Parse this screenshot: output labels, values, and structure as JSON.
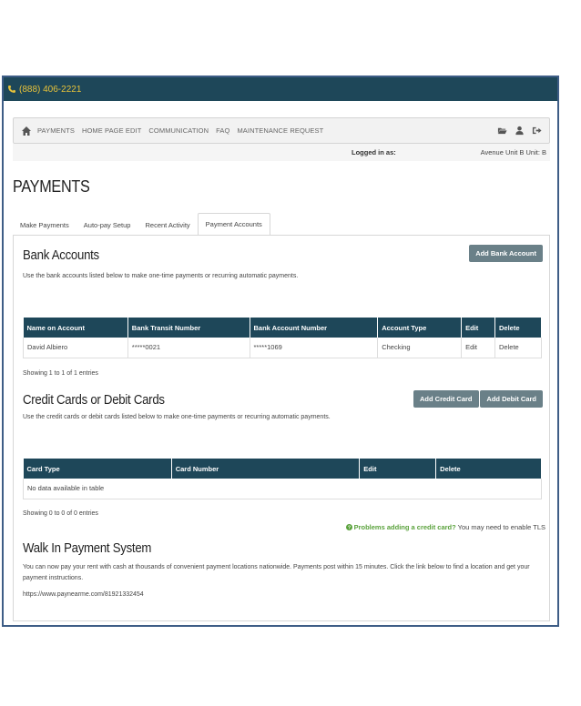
{
  "header": {
    "phone": "(888) 406-2221"
  },
  "nav": {
    "items": [
      "PAYMENTS",
      "HOME PAGE EDIT",
      "COMMUNICATION",
      "FAQ",
      "MAINTENANCE REQUEST"
    ]
  },
  "session": {
    "logged_in_label": "Logged in as:",
    "address": "Avenue Unit B Unit: B"
  },
  "page": {
    "title": "PAYMENTS"
  },
  "tabs": [
    "Make Payments",
    "Auto-pay Setup",
    "Recent Activity",
    "Payment Accounts"
  ],
  "bank": {
    "title": "Bank Accounts",
    "description": "Use the bank accounts listed below to make one-time payments or recurring automatic payments.",
    "add_button": "Add Bank Account",
    "columns": [
      "Name on Account",
      "Bank Transit Number",
      "Bank Account Number",
      "Account Type",
      "Edit",
      "Delete"
    ],
    "rows": [
      [
        "David Albiero",
        "*****0021",
        "*****1069",
        "Checking",
        "Edit",
        "Delete"
      ]
    ],
    "showing": "Showing 1 to 1 of 1 entries"
  },
  "cards": {
    "title": "Credit Cards or Debit Cards",
    "description": "Use the credit cards or debit cards listed below to make one-time payments or recurring automatic payments.",
    "add_credit": "Add Credit Card",
    "add_debit": "Add Debit Card",
    "columns": [
      "Card Type",
      "Card Number",
      "Edit",
      "Delete"
    ],
    "empty": "No data available in table",
    "showing": "Showing 0 to 0 of 0 entries",
    "tls_problem": "Problems adding a credit card?",
    "tls_hint": " You may need to enable TLS"
  },
  "walkin": {
    "title": "Walk In Payment System",
    "description": "You can now pay your rent with cash at thousands of convenient payment locations nationwide. Payments post within 15 minutes. Click the link below to find a location and get your payment instructions.",
    "link": "https://www.paynearme.com/81921332454"
  }
}
